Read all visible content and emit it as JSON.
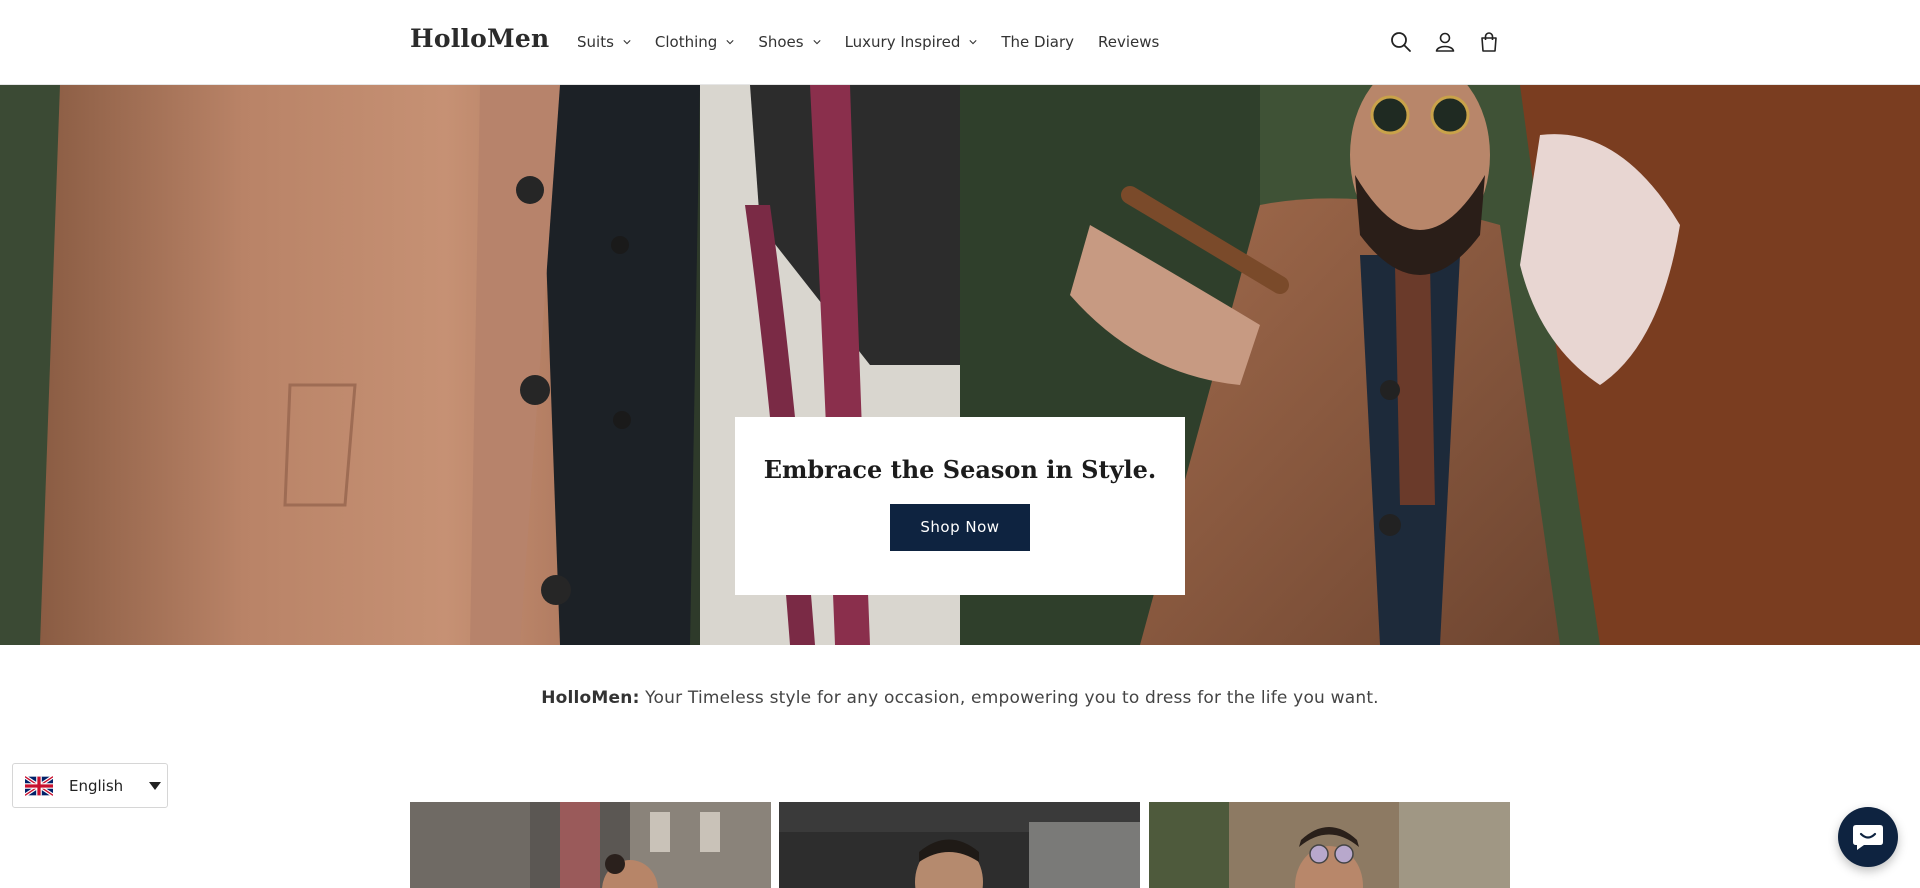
{
  "header": {
    "logo": "HolloMen",
    "nav": [
      {
        "label": "Suits",
        "has_dropdown": true
      },
      {
        "label": "Clothing",
        "has_dropdown": true
      },
      {
        "label": "Shoes",
        "has_dropdown": true
      },
      {
        "label": "Luxury Inspired",
        "has_dropdown": true
      },
      {
        "label": "The Diary",
        "has_dropdown": false
      },
      {
        "label": "Reviews",
        "has_dropdown": false
      }
    ],
    "icons": [
      "search-icon",
      "account-icon",
      "cart-icon"
    ]
  },
  "hero": {
    "title": "Embrace the Season in Style.",
    "button_label": "Shop Now"
  },
  "tagline": {
    "brand": "HolloMen:",
    "text": " Your Timeless style for any occasion, empowering you to dress for the life you want."
  },
  "language": {
    "label": "English",
    "flag": "uk-flag-icon"
  },
  "chat": {
    "icon": "chat-icon"
  },
  "colors": {
    "accent": "#0e2340"
  }
}
